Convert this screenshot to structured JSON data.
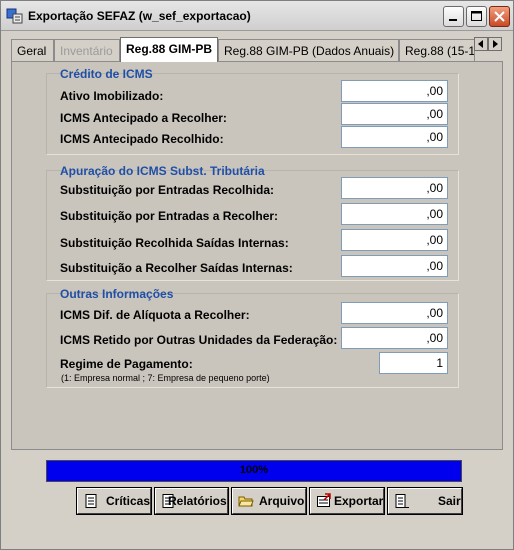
{
  "window": {
    "title": "Exportação SEFAZ (w_sef_exportacao)"
  },
  "tabs": [
    {
      "label": "Geral",
      "state": "normal"
    },
    {
      "label": "Inventário",
      "state": "disabled"
    },
    {
      "label": "Reg.88 GIM-PB",
      "state": "active"
    },
    {
      "label": "Reg.88 GIM-PB (Dados Anuais)",
      "state": "normal"
    },
    {
      "label": "Reg.88 (15-16)",
      "state": "normal"
    }
  ],
  "credito": {
    "title": "Crédito de ICMS",
    "rows": [
      {
        "label": "Ativo Imobilizado:",
        "value": ",00"
      },
      {
        "label": "ICMS Antecipado a Recolher:",
        "value": ",00"
      },
      {
        "label": "ICMS Antecipado Recolhido:",
        "value": ",00"
      }
    ]
  },
  "apuracao": {
    "title": "Apuração do ICMS Subst. Tributária",
    "rows": [
      {
        "label": "Substituição por Entradas Recolhida:",
        "value": ",00"
      },
      {
        "label": "Substituição por Entradas a Recolher:",
        "value": ",00"
      },
      {
        "label": "Substituição Recolhida Saídas Internas:",
        "value": ",00"
      },
      {
        "label": "Substituição a Recolher Saídas Internas:",
        "value": ",00"
      }
    ]
  },
  "outras": {
    "title": "Outras Informações",
    "rows": [
      {
        "label": "ICMS Dif. de Alíquota a Recolher:",
        "value": ",00"
      },
      {
        "label": "ICMS Retido por Outras Unidades da Federação:",
        "value": ",00"
      }
    ],
    "regime_label": "Regime de Pagamento:",
    "regime_value": "1",
    "regime_hint": "(1: Empresa normal ; 7: Empresa de pequeno porte)"
  },
  "progress": {
    "text": "100%",
    "percent": 100,
    "color": "#0000ee"
  },
  "buttons": [
    {
      "label": "Críticas",
      "icon": "document-icon"
    },
    {
      "label": "Relatórios",
      "icon": "report-icon"
    },
    {
      "label": "Arquivo",
      "icon": "folder-open-icon"
    },
    {
      "label": "Exportar",
      "icon": "export-icon"
    },
    {
      "label": "Sair",
      "icon": "exit-icon"
    }
  ]
}
